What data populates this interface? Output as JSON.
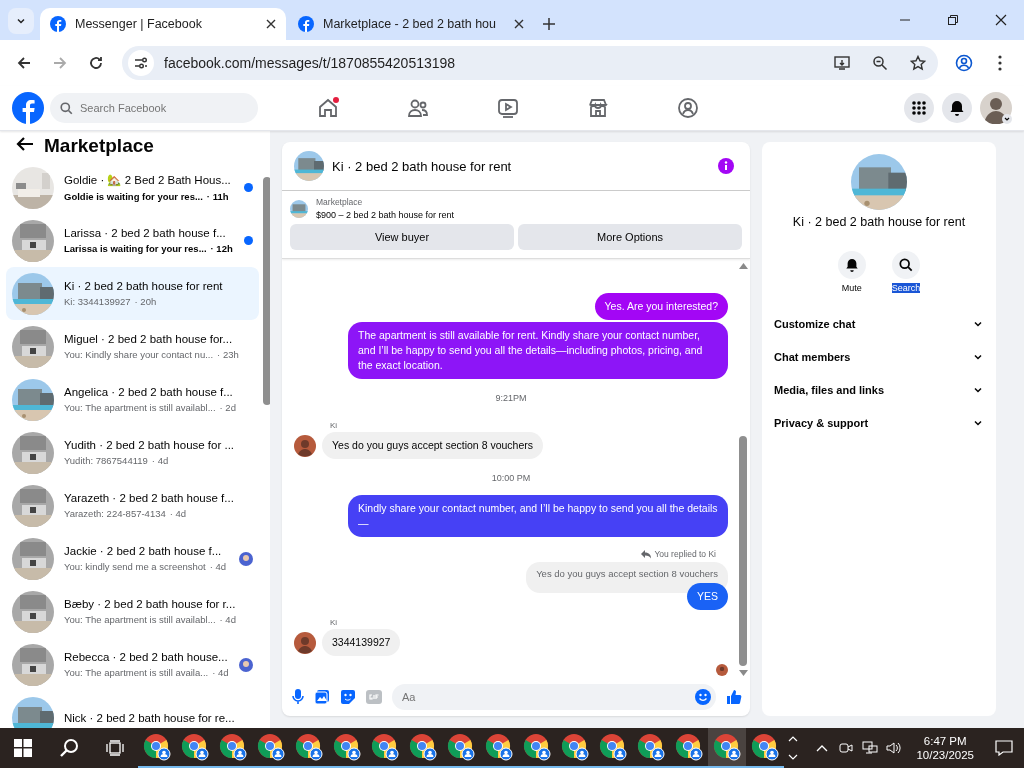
{
  "browser": {
    "tabs": [
      {
        "title": "Messenger | Facebook",
        "selected": true
      },
      {
        "title": "Marketplace - 2 bed 2 bath hou",
        "selected": false
      }
    ],
    "url": "facebook.com/messages/t/1870855420513198"
  },
  "facebook": {
    "search": {
      "placeholder": "Search Facebook"
    },
    "nav": [
      {
        "kind": "home",
        "dot": true
      },
      {
        "kind": "friends",
        "dot": false
      },
      {
        "kind": "video",
        "dot": false
      },
      {
        "kind": "store",
        "dot": false
      },
      {
        "kind": "groups",
        "dot": false
      }
    ]
  },
  "sidebar": {
    "title": "Marketplace",
    "conversations": [
      {
        "title": "Goldie · 🏡 2 Bed 2 Bath Hous...",
        "preview": "Goldie is waiting for your res...",
        "time": "· 11h",
        "unread": true,
        "selected": false,
        "seen_by": false
      },
      {
        "title": "Larissa · 2 bed 2 bath house f...",
        "preview": "Larissa is waiting for your res...",
        "time": "· 12h",
        "unread": true,
        "selected": false,
        "seen_by": false
      },
      {
        "title": "Ki · 2 bed 2 bath house for rent",
        "preview": "Ki: 3344139927",
        "time": "· 20h",
        "unread": false,
        "selected": true,
        "seen_by": false
      },
      {
        "title": "Miguel · 2 bed 2 bath house for...",
        "preview": "You: Kindly share your contact nu...",
        "time": "· 23h",
        "unread": false,
        "selected": false,
        "seen_by": false
      },
      {
        "title": "Angelica · 2 bed 2 bath house f...",
        "preview": "You: The apartment is still availabl...",
        "time": "· 2d",
        "unread": false,
        "selected": false,
        "seen_by": false
      },
      {
        "title": "Yudith · 2 bed 2 bath house for ...",
        "preview": "Yudith: 7867544119",
        "time": "· 4d",
        "unread": false,
        "selected": false,
        "seen_by": false
      },
      {
        "title": "Yarazeth · 2 bed 2 bath house f...",
        "preview": "Yarazeth: 224-857-4134",
        "time": "· 4d",
        "unread": false,
        "selected": false,
        "seen_by": false
      },
      {
        "title": "Jackie · 2 bed 2 bath house f...",
        "preview": "You: kindly send me a screenshot",
        "time": "· 4d",
        "unread": false,
        "selected": false,
        "seen_by": true
      },
      {
        "title": "Bæby · 2 bed 2 bath house for r...",
        "preview": "You: The apartment is still availabl...",
        "time": "· 4d",
        "unread": false,
        "selected": false,
        "seen_by": false
      },
      {
        "title": "Rebecca · 2 bed 2 bath house...",
        "preview": "You: The apartment is still availa...",
        "time": "· 4d",
        "unread": false,
        "selected": false,
        "seen_by": true
      },
      {
        "title": "Nick · 2 bed 2 bath house for re...",
        "unread": false,
        "selected": false,
        "seen_by": false
      }
    ]
  },
  "chat": {
    "title": "Ki · 2 bed 2 bath house for rent",
    "listing": {
      "source": "Marketplace",
      "item": "$900 – 2 bed 2 bath house for rent"
    },
    "buttons": [
      "View buyer",
      "More Options"
    ],
    "messages": [
      {
        "kind": "out",
        "text": "Yes. Are you interested?",
        "color": "#a306f5"
      },
      {
        "kind": "out",
        "text": "The apartment is still available for rent. Kindly share your contact number, and I’ll be happy to send you all the details—including photos, pricing, and the exact location.",
        "color": "#8d15f7"
      },
      {
        "kind": "time",
        "text": "9:21PM"
      },
      {
        "kind": "in",
        "sender": "Ki",
        "text": "Yes do you guys accept section 8 vouchers"
      },
      {
        "kind": "time",
        "text": "10:00 PM"
      },
      {
        "kind": "out",
        "text": "Kindly share your contact number, and I’ll be happy to send you all the details—",
        "color": "#4641f5"
      },
      {
        "kind": "reply",
        "note": "You replied to Ki",
        "quote": "Yes do you guys accept section 8 vouchers",
        "text": "YES",
        "color": "#1a62f5"
      },
      {
        "kind": "in",
        "sender": "Ki",
        "text": "3344139927"
      },
      {
        "kind": "seen"
      }
    ],
    "composer": {
      "placeholder": "Aa"
    }
  },
  "details": {
    "title": "Ki · 2 bed 2 bath house for rent",
    "actions": [
      {
        "kind": "bell",
        "label": "Mute",
        "selected": false
      },
      {
        "kind": "search",
        "label": "Search",
        "selected": true
      }
    ],
    "sections": [
      {
        "label": "Customize chat",
        "expanded": false
      },
      {
        "label": "Chat members",
        "expanded": false
      },
      {
        "label": "Media, files and links",
        "expanded": false
      },
      {
        "label": "Privacy & support",
        "expanded": false
      }
    ]
  },
  "taskbar": {
    "apps": [
      {
        "selected": false
      },
      {
        "selected": false
      },
      {
        "selected": false
      },
      {
        "selected": false
      },
      {
        "selected": false
      },
      {
        "selected": false
      },
      {
        "selected": false
      },
      {
        "selected": false
      },
      {
        "selected": false
      },
      {
        "selected": false
      },
      {
        "selected": false
      },
      {
        "selected": false
      },
      {
        "selected": false
      },
      {
        "selected": false
      },
      {
        "selected": false
      },
      {
        "selected": true
      },
      {
        "selected": false
      }
    ],
    "time": "6:47 PM",
    "date": "10/23/2025"
  }
}
